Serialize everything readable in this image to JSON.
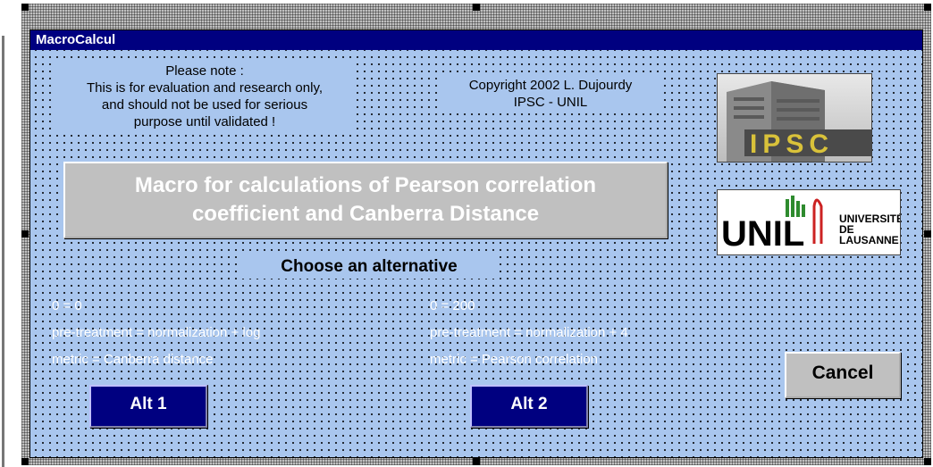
{
  "window": {
    "title": "MacroCalcul"
  },
  "note": {
    "lines": [
      "Please note :",
      "This is for evaluation and research only,",
      "and should not be used for serious",
      "purpose until validated !"
    ]
  },
  "copyright": {
    "lines": [
      "Copyright 2002 L. Dujourdy",
      "IPSC -  UNIL"
    ]
  },
  "logos": {
    "ipsc": {
      "text": "IPSC",
      "icon": "ipsc-building-logo"
    },
    "unil": {
      "mark": "UNIL",
      "lines": [
        "UNIVERSITÉ",
        "DE",
        "LAUSANNE"
      ],
      "icon": "unil-logo"
    }
  },
  "banner": {
    "lines": [
      "Macro for calculations of Pearson correlation",
      "coefficient and Canberra Distance"
    ]
  },
  "choose_label": "Choose an alternative",
  "alternatives": [
    {
      "lines": [
        "0 = 0",
        "pre-treatment = normalization + log",
        "metric = Canberra distance"
      ],
      "button_label": "Alt 1"
    },
    {
      "lines": [
        "0 = 200",
        "pre-treatment = normalization + 4",
        "metric = Pearson correlation"
      ],
      "button_label": "Alt 2"
    }
  ],
  "cancel_label": "Cancel",
  "colors": {
    "form_background": "#a9c6ee",
    "titlebar": "#000080",
    "button_navy": "#000080",
    "button_gray": "#c0c0c0"
  }
}
